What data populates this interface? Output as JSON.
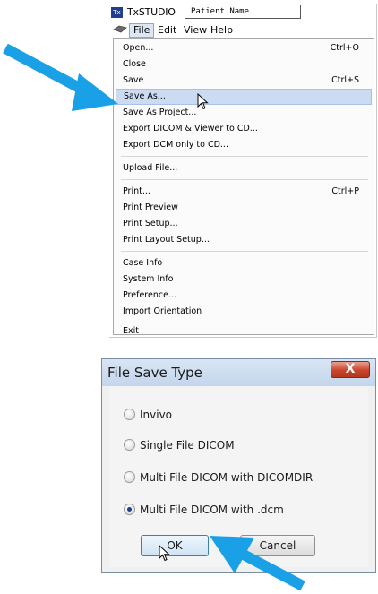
{
  "app": {
    "title": "TxSTUDIO",
    "icon_text": "Tx",
    "patient_field": "Patient Name",
    "menubar": [
      "File",
      "Edit",
      "View",
      "Help"
    ]
  },
  "file_menu": {
    "items": [
      {
        "label": "Open...",
        "shortcut": "Ctrl+O"
      },
      {
        "label": "Close",
        "shortcut": ""
      },
      {
        "label": "Save",
        "shortcut": "Ctrl+S"
      },
      {
        "label": "Save As...",
        "shortcut": ""
      },
      {
        "label": "Save As Project...",
        "shortcut": ""
      },
      {
        "label": "Export DICOM & Viewer to CD...",
        "shortcut": ""
      },
      {
        "label": "Export DCM only to CD...",
        "shortcut": ""
      },
      {
        "label": "Upload File...",
        "shortcut": ""
      },
      {
        "label": "Print...",
        "shortcut": "Ctrl+P"
      },
      {
        "label": "Print Preview",
        "shortcut": ""
      },
      {
        "label": "Print Setup...",
        "shortcut": ""
      },
      {
        "label": "Print Layout Setup...",
        "shortcut": ""
      },
      {
        "label": "Case Info",
        "shortcut": ""
      },
      {
        "label": "System Info",
        "shortcut": ""
      },
      {
        "label": "Preference...",
        "shortcut": ""
      },
      {
        "label": "Import Orientation",
        "shortcut": ""
      },
      {
        "label": "Exit",
        "shortcut": ""
      }
    ],
    "highlighted": "Save As..."
  },
  "dialog": {
    "title": "File Save Type",
    "close_glyph": "X",
    "options": [
      {
        "label": "Invivo",
        "selected": false
      },
      {
        "label": "Single File DICOM",
        "selected": false
      },
      {
        "label": "Multi File DICOM with DICOMDIR",
        "selected": false
      },
      {
        "label": "Multi File DICOM with .dcm",
        "selected": true
      }
    ],
    "ok_label": "OK",
    "cancel_label": "Cancel"
  },
  "colors": {
    "arrow": "#1aa0e6",
    "highlight": "#cbdcf2",
    "close_button": "#c9452b"
  }
}
